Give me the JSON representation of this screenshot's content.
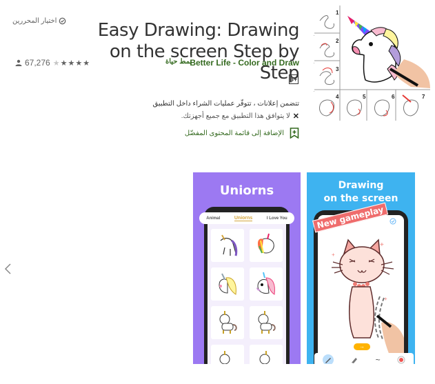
{
  "app": {
    "title": "Easy Drawing: Drawing on the screen Step by Step",
    "developer": "Better Life - Color and Draw",
    "category": "نمط حياة",
    "editors_choice": "اختيار المحررين",
    "rating_count": "67,276",
    "rating_stars": 4,
    "rating_max": 5,
    "content_rating": "3+",
    "ads_notice": "تتضمن إعلانات ، تتوفّر عمليات الشراء داخل التطبيق",
    "compatibility": "لا يتوافق هذا التطبيق مع جميع أجهزتك.",
    "wishlist_label": "الإضافة إلى قائمة المحتوى المفضّل"
  },
  "icon": {
    "step_numbers": [
      "1",
      "2",
      "3",
      "4",
      "5",
      "6",
      "7"
    ]
  },
  "screenshots": [
    {
      "title": "Uniorns",
      "tabs": [
        "Animal",
        "Uniorns",
        "I Love You"
      ],
      "active_tab": "Uniorns",
      "bg_color": "#9c79f2"
    },
    {
      "title_line1": "Drawing",
      "title_line2": "on the screen",
      "badge": "New gameplay",
      "bg_color": "#3eb3f0"
    }
  ],
  "colors": {
    "green_accent": "#33691e",
    "text": "#333333"
  }
}
